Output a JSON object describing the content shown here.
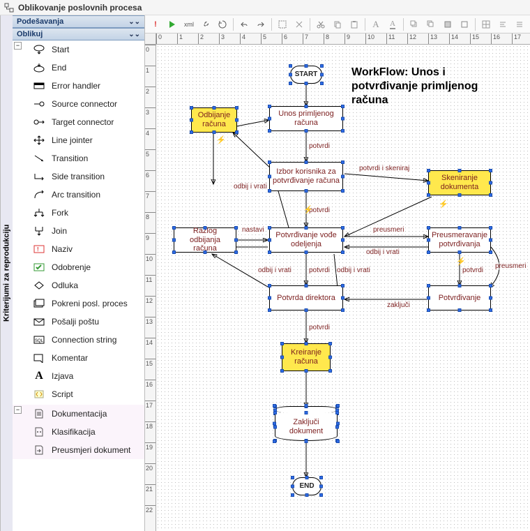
{
  "window": {
    "title": "Oblikovanje poslovnih procesa"
  },
  "sidebar": {
    "vertical_tab": "Kriterijumi za reprodukciju",
    "panel1": "Podešavanja",
    "panel2": "Oblikuj",
    "tools": [
      "Start",
      "End",
      "Error handler",
      "Source connector",
      "Target connector",
      "Line jointer",
      "Transition",
      "Side transition",
      "Arc transition",
      "Fork",
      "Join",
      "Naziv",
      "Odobrenje",
      "Odluka",
      "Pokreni posl. proces",
      "Pošalji poštu",
      "Connection string",
      "Komentar",
      "Izjava",
      "Script"
    ],
    "subtools": [
      "Dokumentacija",
      "Klasifikacija",
      "Preusmjeri dokument"
    ]
  },
  "ruler": {
    "h": [
      "0",
      "1",
      "2",
      "3",
      "4",
      "5",
      "6",
      "7",
      "8",
      "9",
      "10",
      "11",
      "12",
      "13",
      "14",
      "15",
      "16",
      "17"
    ],
    "v": [
      "0",
      "1",
      "2",
      "3",
      "4",
      "5",
      "6",
      "7",
      "8",
      "9",
      "10",
      "11",
      "12",
      "13",
      "14",
      "15",
      "16",
      "17",
      "18",
      "19",
      "20",
      "21",
      "22"
    ]
  },
  "workflow": {
    "title": "WorkFlow: Unos i potvrđivanje primljenog računa",
    "nodes": {
      "start": "START",
      "unos": "Unos primljenog računa",
      "odbijanje": "Odbijanje računa",
      "izbor": "Izbor korisnika za potvrđivanje računa",
      "skeniranje": "Skeniranje dokumenta",
      "razlog": "Razlog odbijanja računa",
      "potvrdjivanje_vode": "Potvrđivanje vođe odeljenja",
      "preusmeravanje": "Preusmeravanje potvrđivanja",
      "potvrda_dir": "Potvrda direktora",
      "potvrdjivanje": "Potvrđivanje",
      "kreiranje": "Kreiranje računa",
      "zakljuci": "Zaključi dokument",
      "end": "END"
    },
    "labels": {
      "potvrdi1": "potvrdi",
      "odbij_vrati1": "odbij i vrati",
      "potvrdi_skeniraj": "potvrdi i skeniraj",
      "potvrdi2": "potvrdi",
      "nastavi": "nastavi",
      "preusmeri": "preusmeri",
      "odbij_vrati2": "odbij i vrati",
      "odbij_vrati3": "odbij i vrati",
      "odbij_vrati4": "odbij i vrati",
      "potvrdi3": "potvrdi",
      "potvrdi4": "potvrdi",
      "preusmeri2": "preusmeri",
      "zakljuci": "zaključi",
      "potvrdi5": "potvrdi"
    }
  }
}
